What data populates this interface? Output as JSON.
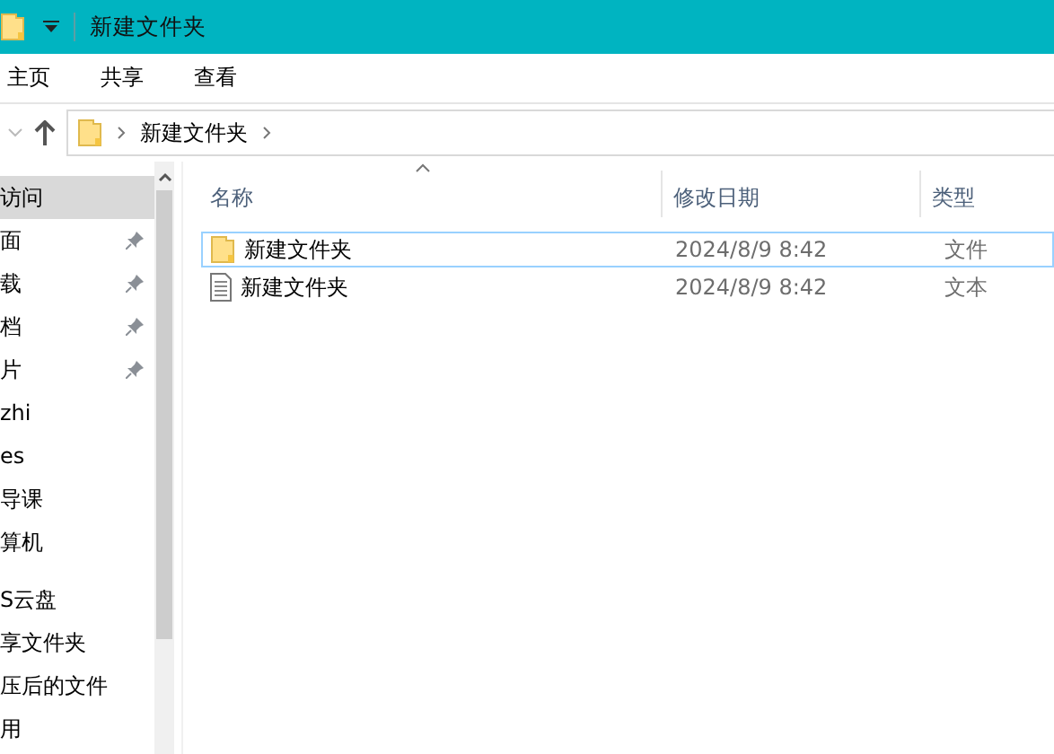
{
  "window": {
    "title": "新建文件夹"
  },
  "ribbon_tabs": [
    {
      "label": "主页"
    },
    {
      "label": "共享"
    },
    {
      "label": "查看"
    }
  ],
  "address": {
    "path": [
      "新建文件夹"
    ]
  },
  "nav_pane": {
    "sections": [
      {
        "items": [
          {
            "label": "访问",
            "selected": true,
            "pinned": false
          },
          {
            "label": "面",
            "selected": false,
            "pinned": true
          },
          {
            "label": "载",
            "selected": false,
            "pinned": true
          },
          {
            "label": "档",
            "selected": false,
            "pinned": true
          },
          {
            "label": "片",
            "selected": false,
            "pinned": true
          },
          {
            "label": "zhi",
            "selected": false,
            "pinned": false
          },
          {
            "label": "es",
            "selected": false,
            "pinned": false
          },
          {
            "label": "导课",
            "selected": false,
            "pinned": false
          },
          {
            "label": "算机",
            "selected": false,
            "pinned": false
          }
        ]
      },
      {
        "items": [
          {
            "label": "S云盘",
            "selected": false,
            "pinned": false
          },
          {
            "label": "享文件夹",
            "selected": false,
            "pinned": false
          },
          {
            "label": "压后的文件",
            "selected": false,
            "pinned": false
          },
          {
            "label": "用",
            "selected": false,
            "pinned": false
          }
        ]
      }
    ]
  },
  "file_list": {
    "columns": [
      {
        "label": "名称",
        "sorted": true
      },
      {
        "label": "修改日期",
        "sorted": false
      },
      {
        "label": "类型",
        "sorted": false
      }
    ],
    "rows": [
      {
        "kind": "folder",
        "name": "新建文件夹",
        "modified": "2024/8/9 8:42",
        "type": "文件",
        "focused": true
      },
      {
        "kind": "text",
        "name": "新建文件夹",
        "modified": "2024/8/9 8:42",
        "type": "文本",
        "focused": false
      }
    ]
  }
}
